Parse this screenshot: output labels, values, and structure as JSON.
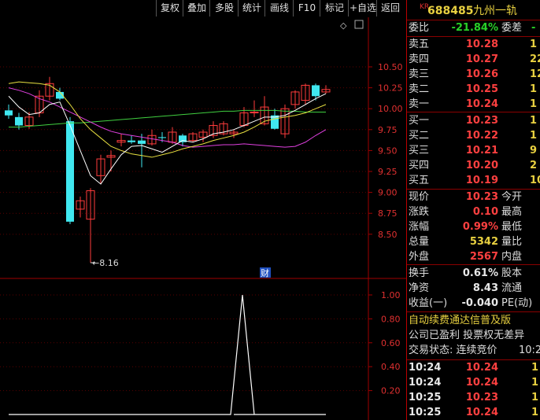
{
  "toolbar": {
    "buttons": [
      "复权",
      "叠加",
      "多股",
      "统计",
      "画线",
      "F10",
      "标记",
      "+自选",
      "返回"
    ]
  },
  "stock": {
    "market_badge": "KR",
    "code": "688485",
    "name": "九州一轨"
  },
  "order_book": {
    "ratio_label": "委比",
    "ratio_value": "-21.84%",
    "diff_label": "委差",
    "diff_value": "-",
    "asks": [
      {
        "label": "卖五",
        "price": "10.28",
        "vol": "1"
      },
      {
        "label": "卖四",
        "price": "10.27",
        "vol": "22"
      },
      {
        "label": "卖三",
        "price": "10.26",
        "vol": "12"
      },
      {
        "label": "卖二",
        "price": "10.25",
        "vol": "1"
      },
      {
        "label": "卖一",
        "price": "10.24",
        "vol": "1"
      }
    ],
    "bids": [
      {
        "label": "买一",
        "price": "10.23",
        "vol": "1"
      },
      {
        "label": "买二",
        "price": "10.22",
        "vol": "1"
      },
      {
        "label": "买三",
        "price": "10.21",
        "vol": "9"
      },
      {
        "label": "买四",
        "price": "10.20",
        "vol": "2"
      },
      {
        "label": "买五",
        "price": "10.19",
        "vol": "10"
      }
    ]
  },
  "quote": [
    {
      "l1": "现价",
      "v1": "10.23",
      "c1": "red",
      "l2": "今开"
    },
    {
      "l1": "涨跌",
      "v1": "0.10",
      "c1": "red",
      "l2": "最高"
    },
    {
      "l1": "涨幅",
      "v1": "0.99%",
      "c1": "red",
      "l2": "最低"
    },
    {
      "l1": "总量",
      "v1": "5342",
      "c1": "yellow",
      "l2": "量比"
    },
    {
      "l1": "外盘",
      "v1": "2567",
      "c1": "red",
      "l2": "内盘"
    }
  ],
  "finance": [
    {
      "l1": "换手",
      "v1": "0.61%",
      "l2": "股本"
    },
    {
      "l1": "净资",
      "v1": "8.43",
      "l2": "流通"
    },
    {
      "l1": "收益(一)",
      "v1": "-0.040",
      "l2": "PE(动)"
    }
  ],
  "notices": {
    "line1": "自动续费通达信普及版",
    "line2": "公司已盈利 投票权无差异",
    "line3_label": "交易状态: 连续竞价",
    "line3_time": "10:2"
  },
  "ticks": [
    {
      "time": "10:24",
      "price": "10.24",
      "vol": "1"
    },
    {
      "time": "10:24",
      "price": "10.24",
      "vol": "1"
    },
    {
      "time": "10:25",
      "price": "10.23",
      "vol": "1"
    },
    {
      "time": "10:25",
      "price": "10.24",
      "vol": "1"
    }
  ],
  "chart_labels": {
    "low_marker": "8.16",
    "finance_badge": "财",
    "diamond": "◇"
  },
  "colors": {
    "up": "#ff3c3c",
    "down": "#40e8f0",
    "ma_white": "#ffffff",
    "ma_yellow": "#e8e040",
    "ma_magenta": "#e040e0",
    "ma_green": "#40d040"
  },
  "chart_data": {
    "type": "candlestick",
    "y_ticks": [
      8.5,
      8.75,
      9.0,
      9.25,
      9.5,
      9.75,
      10.0,
      10.25,
      10.5
    ],
    "ylim": [
      8.0,
      10.75
    ],
    "candles": [
      {
        "o": 9.98,
        "h": 10.05,
        "l": 9.88,
        "c": 9.92
      },
      {
        "o": 9.9,
        "h": 9.95,
        "l": 9.75,
        "c": 9.8
      },
      {
        "o": 9.8,
        "h": 9.96,
        "l": 9.76,
        "c": 9.9
      },
      {
        "o": 9.95,
        "h": 10.22,
        "l": 9.9,
        "c": 10.15
      },
      {
        "o": 10.15,
        "h": 10.38,
        "l": 10.1,
        "c": 10.3
      },
      {
        "o": 10.2,
        "h": 10.25,
        "l": 10.1,
        "c": 10.12
      },
      {
        "o": 9.85,
        "h": 9.9,
        "l": 8.62,
        "c": 8.65
      },
      {
        "o": 8.8,
        "h": 8.95,
        "l": 8.7,
        "c": 8.9
      },
      {
        "o": 8.68,
        "h": 9.05,
        "l": 8.16,
        "c": 9.02
      },
      {
        "o": 9.2,
        "h": 9.45,
        "l": 9.1,
        "c": 9.4
      },
      {
        "o": 9.42,
        "h": 9.5,
        "l": 9.25,
        "c": 9.44
      },
      {
        "o": 9.6,
        "h": 9.7,
        "l": 9.55,
        "c": 9.62
      },
      {
        "o": 9.62,
        "h": 9.68,
        "l": 9.58,
        "c": 9.6
      },
      {
        "o": 9.62,
        "h": 9.7,
        "l": 9.3,
        "c": 9.58
      },
      {
        "o": 9.58,
        "h": 9.75,
        "l": 9.56,
        "c": 9.68
      },
      {
        "o": 9.66,
        "h": 9.72,
        "l": 9.6,
        "c": 9.65
      },
      {
        "o": 9.6,
        "h": 9.78,
        "l": 9.58,
        "c": 9.72
      },
      {
        "o": 9.68,
        "h": 9.7,
        "l": 9.55,
        "c": 9.6
      },
      {
        "o": 9.62,
        "h": 9.72,
        "l": 9.6,
        "c": 9.7
      },
      {
        "o": 9.66,
        "h": 9.75,
        "l": 9.6,
        "c": 9.72
      },
      {
        "o": 9.68,
        "h": 9.85,
        "l": 9.65,
        "c": 9.8
      },
      {
        "o": 9.7,
        "h": 9.85,
        "l": 9.68,
        "c": 9.82
      },
      {
        "o": 9.7,
        "h": 9.75,
        "l": 9.65,
        "c": 9.72
      },
      {
        "o": 9.8,
        "h": 10.02,
        "l": 9.78,
        "c": 9.95
      },
      {
        "o": 9.95,
        "h": 10.1,
        "l": 9.9,
        "c": 9.96
      },
      {
        "o": 9.82,
        "h": 10.15,
        "l": 9.8,
        "c": 10.02
      },
      {
        "o": 9.92,
        "h": 10.0,
        "l": 9.75,
        "c": 9.76
      },
      {
        "o": 9.7,
        "h": 10.05,
        "l": 9.65,
        "c": 10.0
      },
      {
        "o": 10.05,
        "h": 10.22,
        "l": 10.0,
        "c": 10.2
      },
      {
        "o": 10.1,
        "h": 10.3,
        "l": 10.05,
        "c": 10.28
      },
      {
        "o": 10.28,
        "h": 10.3,
        "l": 10.1,
        "c": 10.15
      },
      {
        "o": 10.2,
        "h": 10.28,
        "l": 10.18,
        "c": 10.23
      }
    ],
    "ma_short": [
      10.15,
      10.02,
      9.93,
      9.95,
      10.05,
      10.08,
      9.8,
      9.5,
      9.2,
      9.1,
      9.28,
      9.45,
      9.55,
      9.56,
      9.52,
      9.48,
      9.55,
      9.62,
      9.6,
      9.64,
      9.7,
      9.72,
      9.75,
      9.8,
      9.85,
      9.9,
      9.9,
      9.92,
      9.98,
      10.05,
      10.12,
      10.18
    ],
    "ma_mid": [
      10.3,
      10.32,
      10.31,
      10.3,
      10.28,
      10.2,
      10.05,
      9.88,
      9.75,
      9.65,
      9.55,
      9.5,
      9.46,
      9.44,
      9.42,
      9.45,
      9.48,
      9.52,
      9.55,
      9.58,
      9.62,
      9.65,
      9.68,
      9.72,
      9.78,
      9.85,
      9.88,
      9.9,
      9.92,
      9.95,
      10.0,
      10.05
    ],
    "ma_long": [
      10.25,
      10.22,
      10.18,
      10.12,
      10.08,
      10.02,
      9.96,
      9.9,
      9.84,
      9.78,
      9.73,
      9.7,
      9.68,
      9.66,
      9.64,
      9.62,
      9.6,
      9.56,
      9.54,
      9.55,
      9.56,
      9.57,
      9.57,
      9.58,
      9.57,
      9.56,
      9.55,
      9.54,
      9.55,
      9.6,
      9.68,
      9.75
    ],
    "ma_base": [
      9.78,
      9.78,
      9.79,
      9.8,
      9.81,
      9.82,
      9.83,
      9.83,
      9.84,
      9.85,
      9.86,
      9.87,
      9.88,
      9.89,
      9.9,
      9.91,
      9.92,
      9.93,
      9.94,
      9.95,
      9.96,
      9.97,
      9.97,
      9.98,
      9.98,
      9.98,
      9.98,
      9.97,
      9.97,
      9.96,
      9.96,
      9.96
    ],
    "sub_chart": {
      "y_ticks": [
        0.2,
        0.4,
        0.6,
        0.8,
        1.0
      ],
      "ylim": [
        0,
        1.1
      ],
      "values": [
        0,
        0,
        0,
        0,
        0,
        0,
        0,
        0,
        0,
        0,
        0,
        0,
        0,
        0,
        0,
        0,
        0,
        0,
        0,
        0,
        1,
        0,
        0,
        0,
        0,
        0,
        0,
        0,
        0,
        0,
        0,
        0
      ]
    }
  }
}
